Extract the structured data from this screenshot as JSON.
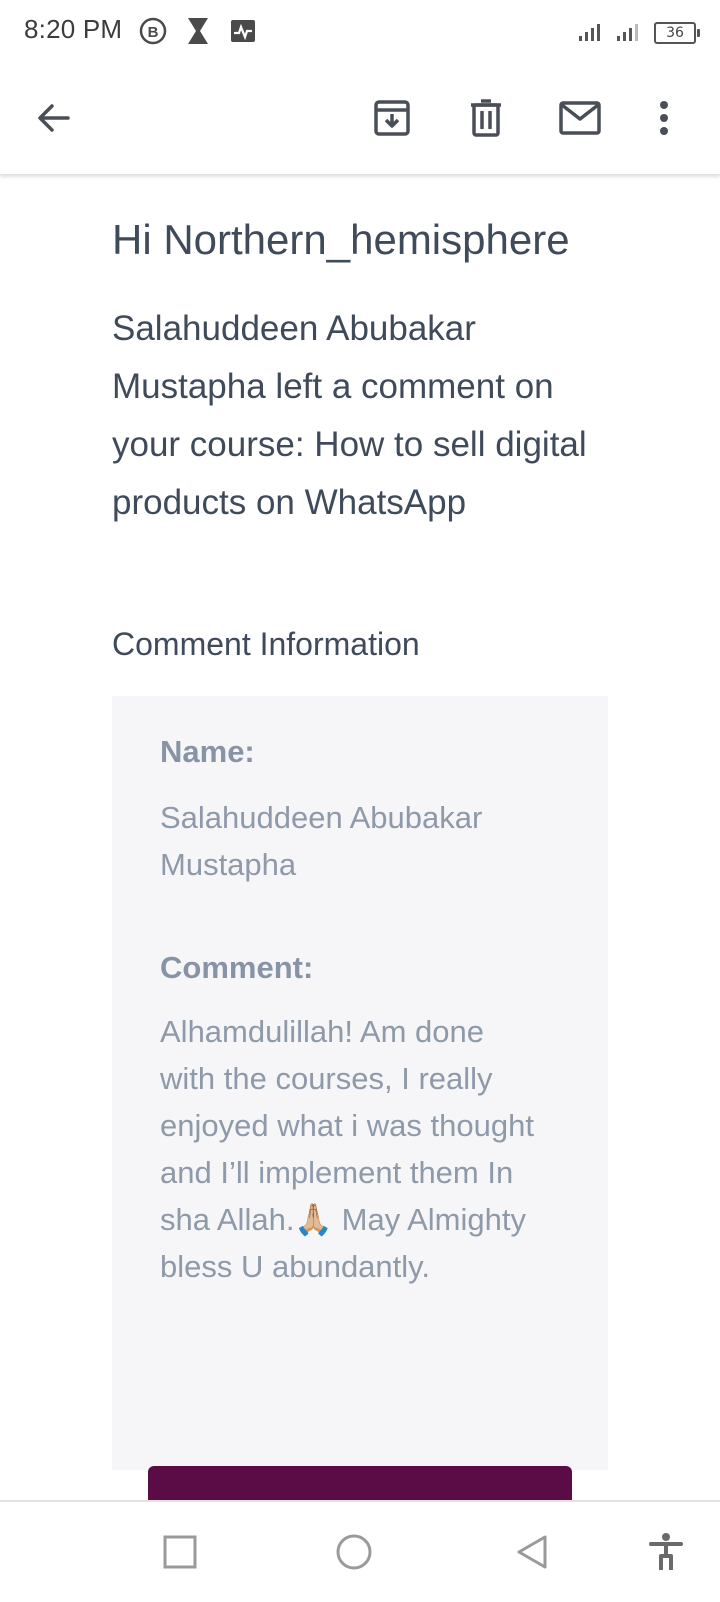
{
  "status_bar": {
    "time": "8:20 PM",
    "left_icons": [
      "b-circle-icon",
      "hourglass-icon",
      "activity-icon"
    ],
    "right_icons": [
      "signal-icon",
      "signal-icon"
    ],
    "battery": "36"
  },
  "toolbar": {
    "back_icon": "arrow-back-icon",
    "actions": [
      "archive-icon",
      "delete-icon",
      "mark-unread-icon",
      "more-vert-icon"
    ]
  },
  "email": {
    "greeting": "Hi Northern_hemisphere",
    "intro": "Salahuddeen Abubakar Mustapha left a comment on your course: How to sell digital products on WhatsApp",
    "section_title": "Comment Information",
    "name_label": "Name:",
    "name_value": "Salahuddeen Abubakar Mustapha",
    "comment_label": "Comment:",
    "comment_value": "Alhamdulillah! Am done with the courses, I really enjoyed what i was thought and I’ll implement them In sha Allah.🙏🏼 May Almighty bless U abundantly."
  },
  "colors": {
    "text": "#3f4a5a",
    "muted": "#8e99a9",
    "card_bg": "#f6f6f8",
    "button": "#5b0b46"
  },
  "nav_bar": {
    "buttons": [
      "recents-icon",
      "home-icon",
      "back-icon",
      "accessibility-icon"
    ]
  }
}
